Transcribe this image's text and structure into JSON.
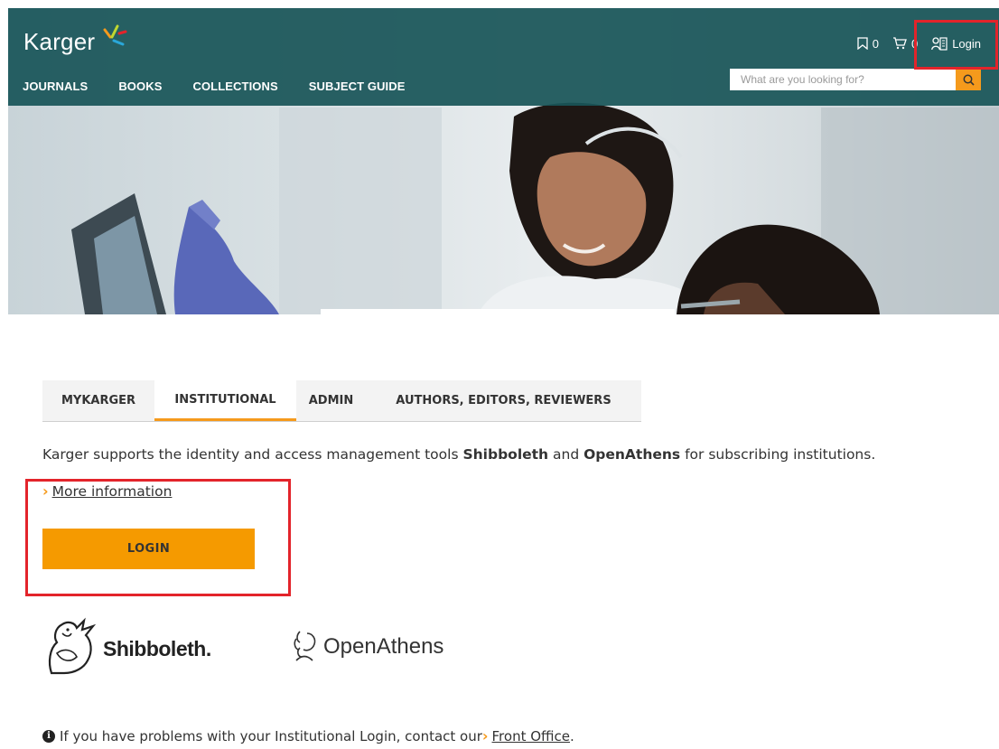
{
  "brand": {
    "name": "Karger"
  },
  "nav": {
    "items": [
      {
        "label": "JOURNALS"
      },
      {
        "label": "BOOKS"
      },
      {
        "label": "COLLECTIONS"
      },
      {
        "label": "SUBJECT GUIDE"
      }
    ]
  },
  "utility": {
    "bookmarks_count": "0",
    "cart_count": "0",
    "login_label": "Login"
  },
  "search": {
    "placeholder": "What are you looking for?"
  },
  "tabs": [
    {
      "label": "MYKARGER",
      "active": false
    },
    {
      "label": "INSTITUTIONAL",
      "active": true
    },
    {
      "label": "ADMIN",
      "active": false
    },
    {
      "label": "AUTHORS, EDITORS, REVIEWERS",
      "active": false
    }
  ],
  "intro": {
    "before": "Karger supports the identity and access management tools ",
    "tool1": "Shibboleth",
    "middle": " and ",
    "tool2": "OpenAthens",
    "after": " for subscribing institutions."
  },
  "more_info_label": "More information",
  "login_button_label": "LOGIN",
  "logos": {
    "shibboleth": "Shibboleth.",
    "openathens": "OpenAthens"
  },
  "help": {
    "text": "If you have problems with your Institutional Login, contact our ",
    "link": "Front Office",
    "end": "."
  },
  "colors": {
    "header_teal": "#1a5558",
    "accent_orange": "#f59a00",
    "highlight_red": "#e3242b"
  }
}
